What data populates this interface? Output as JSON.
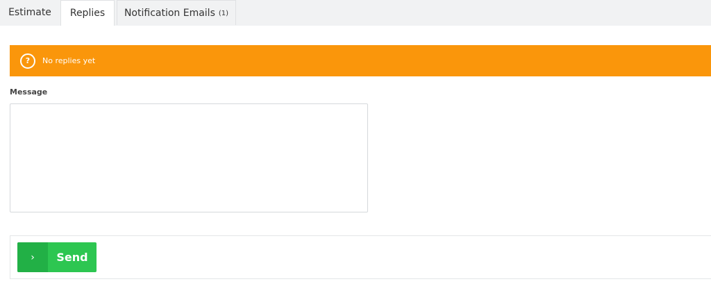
{
  "tabs": [
    {
      "label": "Estimate"
    },
    {
      "label": "Replies",
      "active": true
    },
    {
      "label": "Notification Emails",
      "count": "(1)"
    }
  ],
  "alert": {
    "icon": "question-circle-icon",
    "icon_glyph": "?",
    "text": "No replies yet",
    "color": "#fa960b"
  },
  "form": {
    "message_label": "Message",
    "message_value": ""
  },
  "actions": {
    "send_icon": "chevron-right-icon",
    "send_glyph": "›",
    "send_label": "Send",
    "color": "#2dc651"
  }
}
